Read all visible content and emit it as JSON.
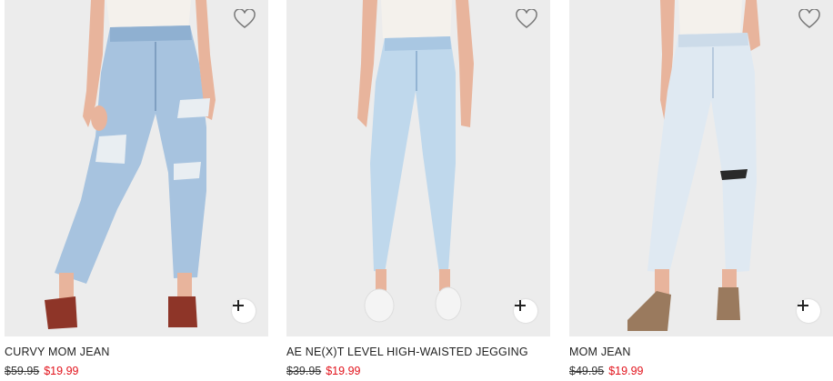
{
  "products": [
    {
      "title": "CURVY MOM JEAN",
      "original_price": "$59.95",
      "sale_price": "$19.99",
      "wash_color": "#a7c3df",
      "shoe_color": "#8e3528",
      "icons": [
        "heart-outline-icon",
        "plus-icon"
      ]
    },
    {
      "title": "AE NE(X)T LEVEL HIGH-WAISTED JEGGING",
      "original_price": "$39.95",
      "sale_price": "$19.99",
      "wash_color": "#bfd8ec",
      "shoe_color": "#f4f4f4",
      "icons": [
        "heart-outline-icon",
        "plus-icon"
      ]
    },
    {
      "title": "MOM JEAN",
      "original_price": "$49.95",
      "sale_price": "$19.99",
      "wash_color": "#dfe9f2",
      "shoe_color": "#9a7a5e",
      "icons": [
        "heart-outline-icon",
        "plus-icon"
      ]
    }
  ],
  "colors": {
    "sale": "#e2121b",
    "photo_bg": "#ececec"
  }
}
